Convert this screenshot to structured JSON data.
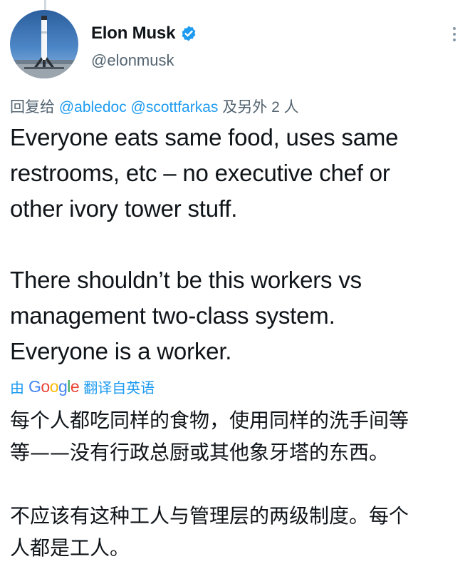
{
  "author": {
    "name": "Elon Musk",
    "handle": "@elonmusk",
    "verified": true,
    "avatar_icon": "rocket-launch-avatar"
  },
  "reply": {
    "prefix": "回复给",
    "mentions": "@abledoc @scottfarkas",
    "suffix": "及另外 2 人"
  },
  "tweet": {
    "para1_lines": [
      "Everyone eats same food, uses same",
      "restrooms, etc – no executive chef or",
      "other ivory tower stuff."
    ],
    "para2_lines": [
      "There shouldn’t be this workers vs",
      "management two-class system.",
      "Everyone is a worker."
    ]
  },
  "translation": {
    "by": "由",
    "google": [
      "G",
      "o",
      "o",
      "g",
      "l",
      "e"
    ],
    "label": "翻译自英语",
    "para1_lines": [
      "每个人都吃同样的食物，使用同样的洗手间等",
      "等——没有行政总厨或其他象牙塔的东西。"
    ],
    "para2_lines": [
      "不应该有这种工人与管理层的两级制度。每个",
      "人都是工人。"
    ]
  },
  "colors": {
    "accent": "#1d9bf0",
    "secondary_text": "#536471",
    "primary_text": "#0f1419"
  }
}
